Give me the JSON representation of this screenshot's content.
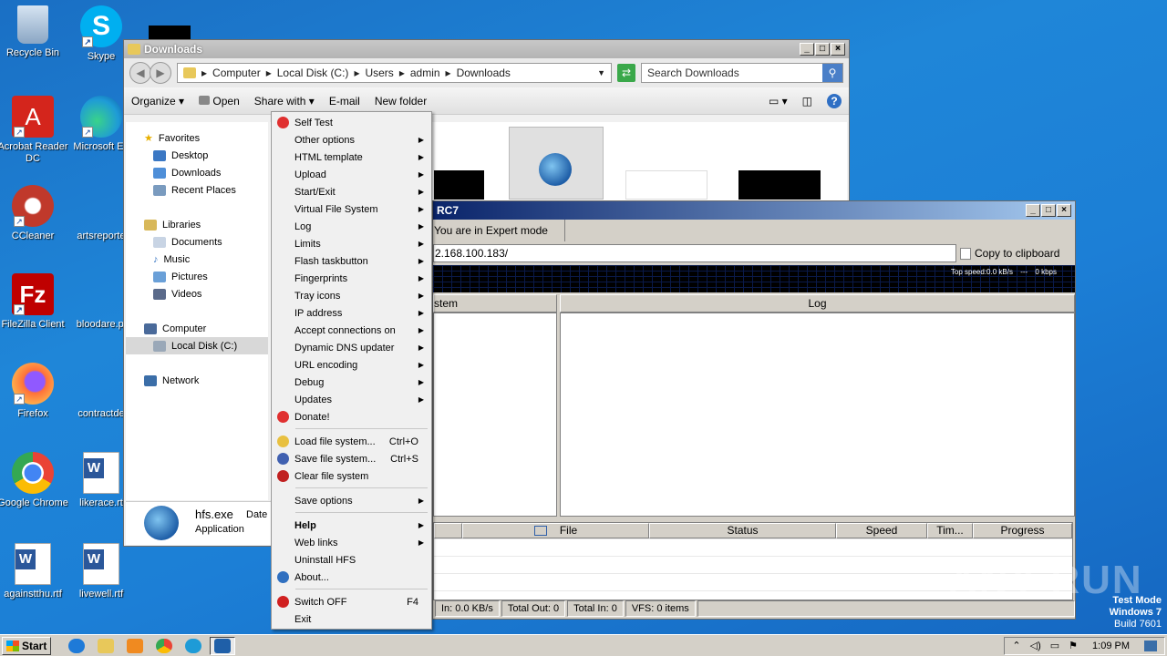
{
  "desktop": {
    "icons": [
      {
        "label": "Recycle Bin",
        "color": "#9fb7d4"
      },
      {
        "label": "Skype",
        "color": "#00aff0"
      },
      {
        "label": "Acrobat Reader DC",
        "color": "#d4251c"
      },
      {
        "label": "Microsoft Ed",
        "color": "#1e9bd7"
      },
      {
        "label": "CCleaner",
        "color": "#c0392b"
      },
      {
        "label": "artsreporte",
        "color": "#ffffff"
      },
      {
        "label": "FileZilla Client",
        "color": "#bf0000"
      },
      {
        "label": "bloodare.pi",
        "color": "#ffffff"
      },
      {
        "label": "Firefox",
        "color": "#ff7139"
      },
      {
        "label": "contractde",
        "color": "#ffffff"
      },
      {
        "label": "Google Chrome",
        "color": "#4285f4"
      },
      {
        "label": "likerace.rt",
        "color": "#2b579a"
      },
      {
        "label": "againstthu.rtf",
        "color": "#2b579a"
      },
      {
        "label": "livewell.rtf",
        "color": "#2b579a"
      }
    ],
    "watermark": {
      "brand": "ANY RUN",
      "line1": "Test Mode",
      "line2": "Windows 7",
      "line3": "Build 7601"
    }
  },
  "explorer": {
    "title": "Downloads",
    "breadcrumb": [
      "Computer",
      "Local Disk (C:)",
      "Users",
      "admin",
      "Downloads"
    ],
    "search_placeholder": "Search Downloads",
    "toolbar": {
      "organize": "Organize",
      "open": "Open",
      "share": "Share with",
      "email": "E-mail",
      "new_folder": "New folder"
    },
    "nav": {
      "favorites": "Favorites",
      "desktop": "Desktop",
      "downloads": "Downloads",
      "recent": "Recent Places",
      "libraries": "Libraries",
      "documents": "Documents",
      "music": "Music",
      "pictures": "Pictures",
      "videos": "Videos",
      "computer": "Computer",
      "local_disk": "Local Disk (C:)",
      "network": "Network"
    },
    "details": {
      "name": "hfs.exe",
      "type": "Application",
      "date_label": "Date"
    }
  },
  "menu": {
    "items": [
      {
        "label": "Self Test",
        "icon": "self-test-icon"
      },
      {
        "label": "Other options",
        "sub": true
      },
      {
        "label": "HTML template",
        "sub": true
      },
      {
        "label": "Upload",
        "sub": true
      },
      {
        "label": "Start/Exit",
        "sub": true
      },
      {
        "label": "Virtual File System",
        "sub": true
      },
      {
        "label": "Log",
        "sub": true
      },
      {
        "label": "Limits",
        "sub": true
      },
      {
        "label": "Flash taskbutton",
        "sub": true
      },
      {
        "label": "Fingerprints",
        "sub": true
      },
      {
        "label": "Tray icons",
        "sub": true
      },
      {
        "label": "IP address",
        "sub": true
      },
      {
        "label": "Accept connections on",
        "sub": true
      },
      {
        "label": "Dynamic DNS updater",
        "sub": true
      },
      {
        "label": "URL encoding",
        "sub": true
      },
      {
        "label": "Debug",
        "sub": true
      },
      {
        "label": "Updates",
        "sub": true
      },
      {
        "label": "Donate!",
        "icon": "heart-icon"
      }
    ],
    "items2": [
      {
        "label": "Load file system...",
        "shortcut": "Ctrl+O",
        "icon": "load-icon"
      },
      {
        "label": "Save file system...",
        "shortcut": "Ctrl+S",
        "icon": "save-icon"
      },
      {
        "label": "Clear file system",
        "icon": "clear-icon"
      }
    ],
    "save_options": "Save options",
    "items3": [
      {
        "label": "Help",
        "sub": true,
        "bold": true
      },
      {
        "label": "Web links",
        "sub": true
      },
      {
        "label": "Uninstall HFS"
      },
      {
        "label": "About...",
        "icon": "info-icon"
      }
    ],
    "switch_off": "Switch OFF",
    "switch_off_sc": "F4",
    "exit": "Exit"
  },
  "hfs": {
    "title": "RC7",
    "mode": "You are in Expert mode",
    "url": "2.168.100.183/",
    "copy": "Copy to clipboard",
    "graph": {
      "top_speed": "Top speed:0.0 kB/s",
      "sep": "---",
      "kbps": "0 kbps"
    },
    "vfs_header": "stem",
    "log_header": "Log",
    "columns": [
      "File",
      "Status",
      "Speed",
      "Tim...",
      "Progress"
    ],
    "status": [
      "In: 0.0 KB/s",
      "Total Out: 0",
      "Total In: 0",
      "VFS: 0 items"
    ]
  },
  "taskbar": {
    "start": "Start",
    "clock": "1:09 PM"
  }
}
